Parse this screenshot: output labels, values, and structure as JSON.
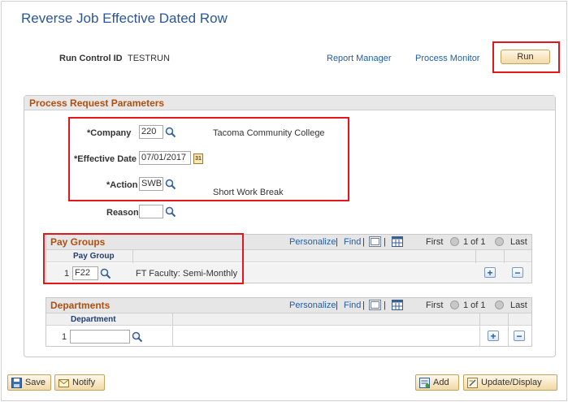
{
  "page": {
    "title": "Reverse Job Effective Dated Row"
  },
  "header": {
    "run_control_label": "Run Control ID",
    "run_control_value": "TESTRUN",
    "report_manager": "Report Manager",
    "process_monitor": "Process Monitor",
    "run_button": "Run"
  },
  "params": {
    "section_title": "Process Request Parameters",
    "company_label": "*Company",
    "company_value": "220",
    "company_desc": "Tacoma Community College",
    "eff_date_label": "*Effective Date",
    "eff_date_value": "07/01/2017",
    "calendar_glyph": "31",
    "action_label": "*Action",
    "action_value": "SWB",
    "action_desc": "Short Work Break",
    "reason_label": "Reason",
    "reason_value": ""
  },
  "pay_groups": {
    "title": "Pay Groups",
    "personalize": "Personalize",
    "find": "Find",
    "pipe": "|",
    "first": "First",
    "count": "1 of 1",
    "last": "Last",
    "column_header": "Pay Group",
    "rows": [
      {
        "num": "1",
        "value": "F22",
        "desc": "FT Faculty: Semi-Monthly"
      }
    ],
    "add": "+",
    "remove": "−"
  },
  "departments": {
    "title": "Departments",
    "personalize": "Personalize",
    "find": "Find",
    "pipe": "|",
    "first": "First",
    "count": "1 of 1",
    "last": "Last",
    "column_header": "Department",
    "rows": [
      {
        "num": "1",
        "value": ""
      }
    ],
    "add": "+",
    "remove": "−"
  },
  "footer": {
    "save": "Save",
    "notify": "Notify",
    "add": "Add",
    "update_display": "Update/Display"
  },
  "colors": {
    "title_blue": "#2b5797",
    "section_orange": "#b04f0f",
    "link_blue": "#1f5fa8",
    "highlight_red": "#e3171b"
  },
  "icons": {
    "lookup": "magnifier-icon",
    "calendar": "calendar-icon",
    "zoom": "view-all-icon",
    "download": "grid-download-icon",
    "prev": "prev-arrow-icon",
    "next": "next-arrow-icon",
    "save": "save-icon",
    "notify": "notify-icon",
    "add": "add-icon",
    "update": "update-display-icon"
  }
}
